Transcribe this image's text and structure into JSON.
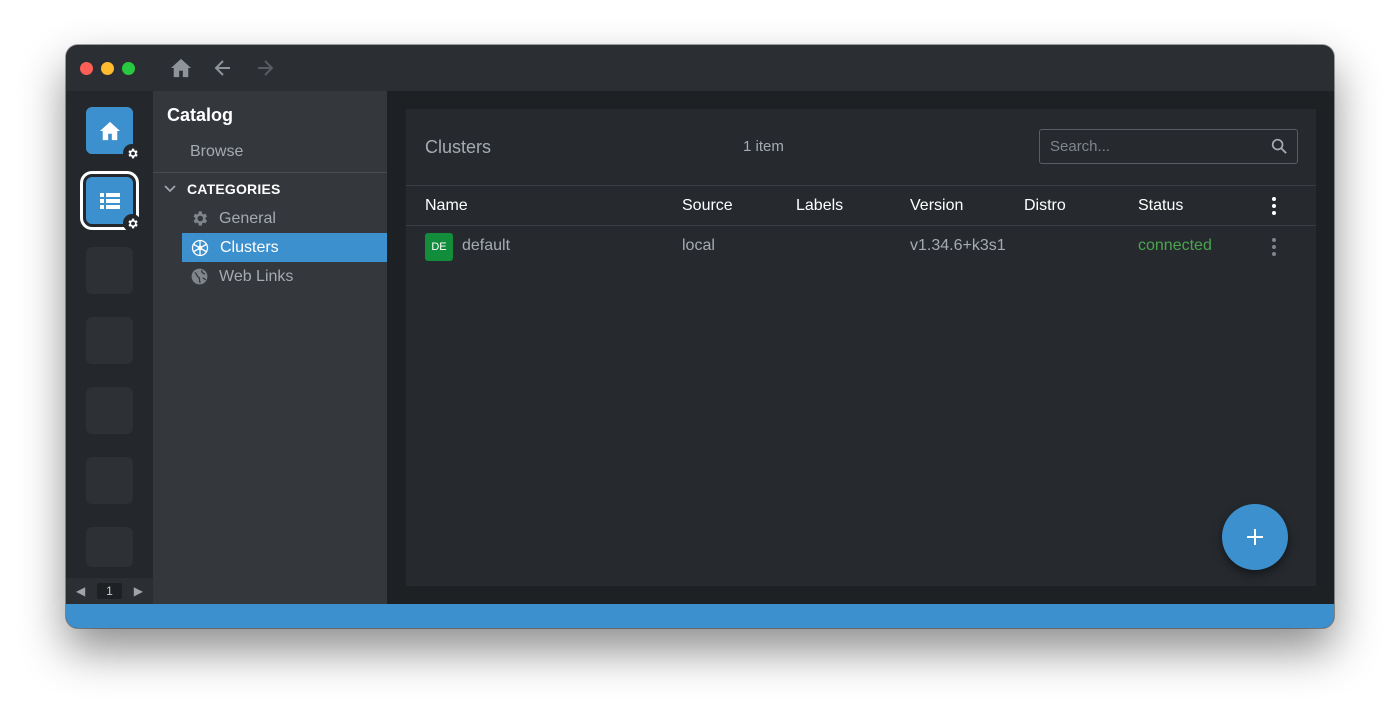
{
  "titlebar": {
    "nav": [
      {
        "icon": "home-icon",
        "enabled": true
      },
      {
        "icon": "arrow-left-icon",
        "enabled": true
      },
      {
        "icon": "arrow-right-icon",
        "enabled": false
      }
    ]
  },
  "hotbar": {
    "items": [
      {
        "icon": "home-icon",
        "state": "filled",
        "badge": "gear-icon"
      },
      {
        "icon": "list-icon",
        "state": "active",
        "badge": "gear-icon"
      },
      {
        "state": "empty"
      },
      {
        "state": "empty"
      },
      {
        "state": "empty"
      },
      {
        "state": "empty"
      },
      {
        "state": "empty"
      }
    ],
    "page": "1"
  },
  "sidebar": {
    "title": "Catalog",
    "browse": "Browse",
    "categories_label": "CATEGORIES",
    "items": [
      {
        "label": "General",
        "icon": "gear-icon"
      },
      {
        "label": "Clusters",
        "icon": "kubernetes-icon",
        "selected": true
      },
      {
        "label": "Web Links",
        "icon": "globe-icon"
      }
    ]
  },
  "main": {
    "heading": "Clusters",
    "count": "1 item",
    "search_placeholder": "Search...",
    "columns": [
      "Name",
      "Source",
      "Labels",
      "Version",
      "Distro",
      "Status"
    ],
    "rows": [
      {
        "avatar": "DE",
        "name": "default",
        "source": "local",
        "labels": "",
        "version": "v1.34.6+k3s1",
        "distro": "",
        "status": "connected"
      }
    ],
    "fab_icon": "plus-icon"
  },
  "colors": {
    "accent": "#3d90ce",
    "status_connected": "#4aa54e",
    "avatar_bg": "#118d3b"
  }
}
